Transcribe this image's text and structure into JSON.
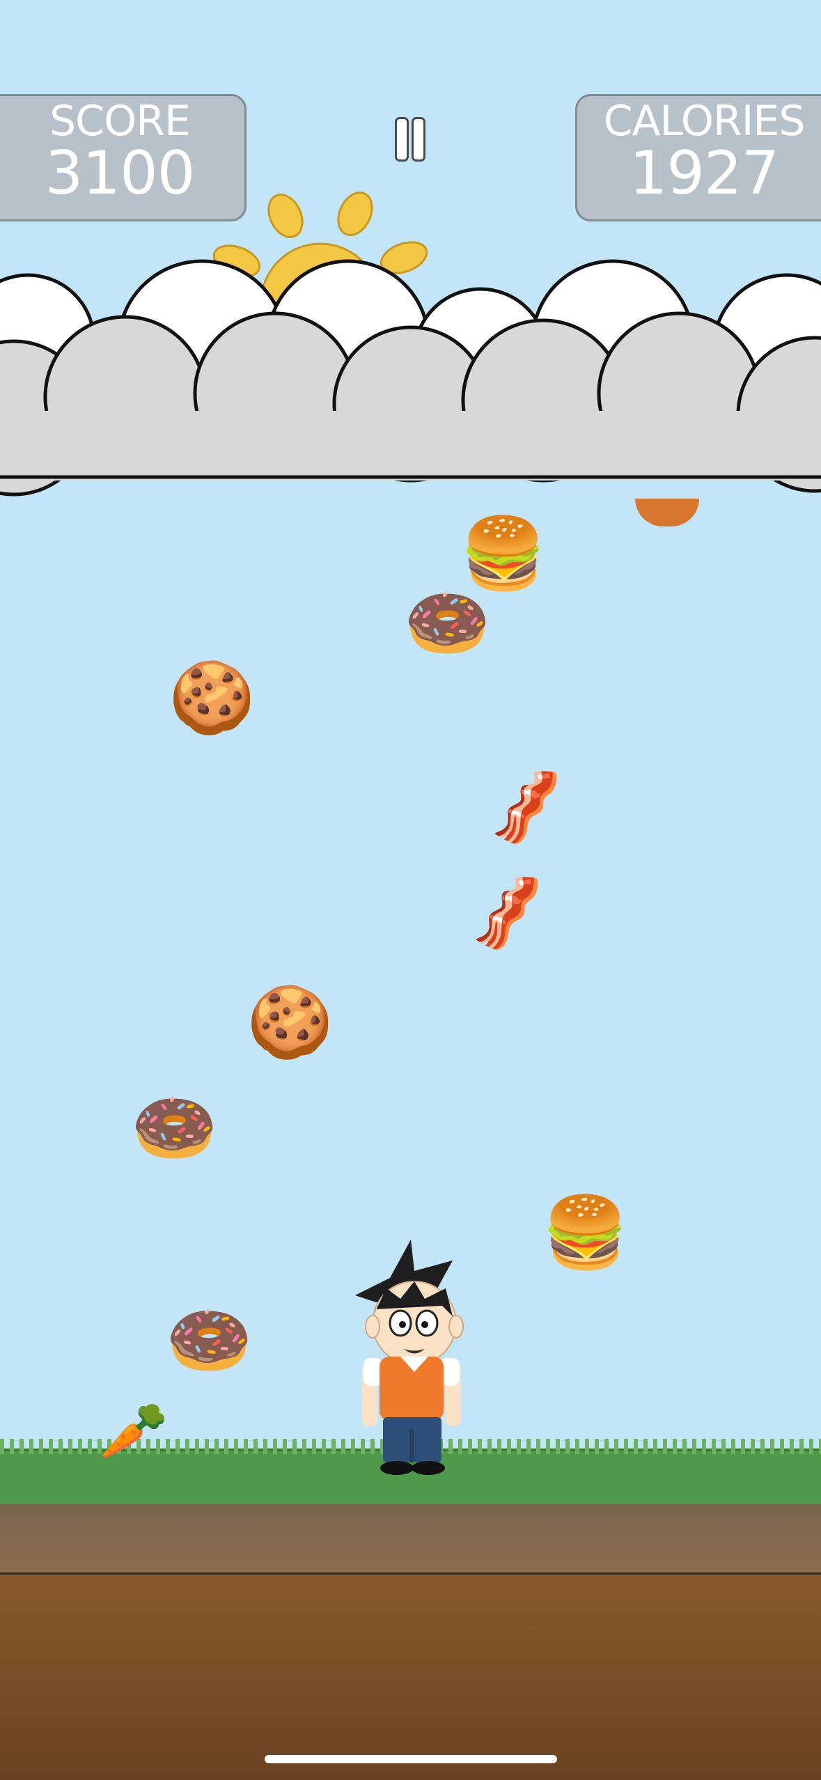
{
  "hud": {
    "score_label": "SCORE",
    "score_value": "3100",
    "calories_label": "CALORIES",
    "calories_value": "1927"
  },
  "foods": {
    "burger": "🍔",
    "donut": "🍩",
    "cookie": "🍪",
    "bacon": "🥓",
    "carrot": "🥕"
  },
  "colors": {
    "sky": "#c2e6f7",
    "hud_panel": "#b7c1c9",
    "sun": "#f4c842",
    "grass": "#4f9a4a",
    "dirt": "#7a4c26",
    "shirt": "#f07a2b",
    "pants": "#2d4f7a"
  }
}
